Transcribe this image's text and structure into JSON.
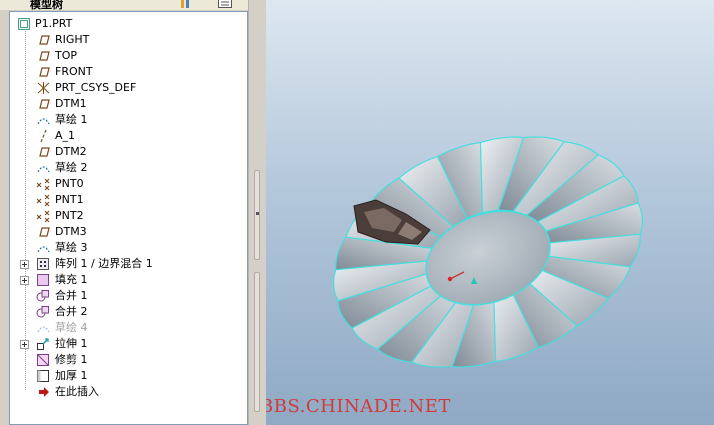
{
  "toolbar": {
    "panel_title": "模型树",
    "columns_icon": "columns-icon",
    "settings_icon": "tree-settings-icon"
  },
  "tree": {
    "root": {
      "label": "P1.PRT",
      "icon": "part-icon"
    },
    "items": [
      {
        "label": "RIGHT",
        "icon": "datum-plane-icon",
        "expandable": false,
        "muted": false
      },
      {
        "label": "TOP",
        "icon": "datum-plane-icon",
        "expandable": false,
        "muted": false
      },
      {
        "label": "FRONT",
        "icon": "datum-plane-icon",
        "expandable": false,
        "muted": false
      },
      {
        "label": "PRT_CSYS_DEF",
        "icon": "coordinate-system-icon",
        "expandable": false,
        "muted": false
      },
      {
        "label": "DTM1",
        "icon": "datum-plane-icon",
        "expandable": false,
        "muted": false
      },
      {
        "label": "草绘 1",
        "icon": "sketch-icon",
        "expandable": false,
        "muted": false
      },
      {
        "label": "A_1",
        "icon": "datum-axis-icon",
        "expandable": false,
        "muted": false
      },
      {
        "label": "DTM2",
        "icon": "datum-plane-icon",
        "expandable": false,
        "muted": false
      },
      {
        "label": "草绘 2",
        "icon": "sketch-icon",
        "expandable": false,
        "muted": false
      },
      {
        "label": "PNT0",
        "icon": "datum-point-icon",
        "expandable": false,
        "muted": false
      },
      {
        "label": "PNT1",
        "icon": "datum-point-icon",
        "expandable": false,
        "muted": false
      },
      {
        "label": "PNT2",
        "icon": "datum-point-icon",
        "expandable": false,
        "muted": false
      },
      {
        "label": "DTM3",
        "icon": "datum-plane-icon",
        "expandable": false,
        "muted": false
      },
      {
        "label": "草绘 3",
        "icon": "sketch-icon",
        "expandable": false,
        "muted": false
      },
      {
        "label": "阵列 1 / 边界混合 1",
        "icon": "pattern-icon",
        "expandable": true,
        "muted": false
      },
      {
        "label": "填充 1",
        "icon": "fill-icon",
        "expandable": true,
        "muted": false
      },
      {
        "label": "合并 1",
        "icon": "merge-icon",
        "expandable": false,
        "muted": false
      },
      {
        "label": "合并 2",
        "icon": "merge-icon",
        "expandable": false,
        "muted": false
      },
      {
        "label": "草绘 4",
        "icon": "sketch-icon",
        "expandable": false,
        "muted": true
      },
      {
        "label": "拉伸 1",
        "icon": "extrude-icon",
        "expandable": true,
        "muted": false
      },
      {
        "label": "修剪 1",
        "icon": "trim-icon",
        "expandable": false,
        "muted": false
      },
      {
        "label": "加厚 1",
        "icon": "thicken-icon",
        "expandable": false,
        "muted": false
      },
      {
        "label": "在此插入",
        "icon": "insert-here-arrow-icon",
        "expandable": false,
        "muted": false
      }
    ]
  },
  "viewport": {
    "watermark": "BBS.CHINADE.NET",
    "model_colors": {
      "surface": "#b9c0c8",
      "edge": "#3fe0e0",
      "rock": "#5a4a44"
    }
  }
}
